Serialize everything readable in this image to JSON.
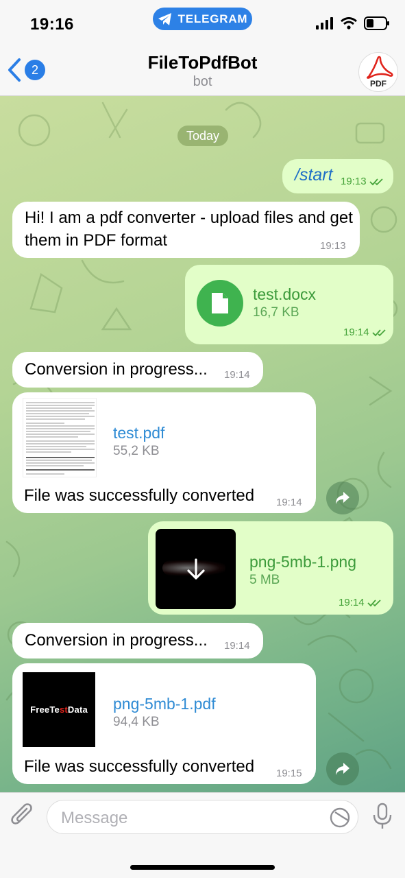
{
  "status": {
    "time": "19:16",
    "app_pill": "TELEGRAM"
  },
  "header": {
    "back_count": "2",
    "title": "FileToPdfBot",
    "subtitle": "bot",
    "avatar_label": "PDF"
  },
  "chat": {
    "date_label": "Today",
    "messages": [
      {
        "text": "/start",
        "time": "19:13"
      },
      {
        "text": "Hi! I am a pdf converter - upload files and get them in PDF format",
        "time": "19:13"
      },
      {
        "file_name": "test.docx",
        "file_size": "16,7 KB",
        "time": "19:14"
      },
      {
        "text": "Conversion in progress...",
        "time": "19:14"
      },
      {
        "file_name": "test.pdf",
        "file_size": "55,2 KB",
        "caption": "File was successfully converted",
        "time": "19:14"
      },
      {
        "file_name": "png-5mb-1.png",
        "file_size": "5 MB",
        "time": "19:14"
      },
      {
        "text": "Conversion in progress...",
        "time": "19:14"
      },
      {
        "file_name": "png-5mb-1.pdf",
        "file_size": "94,4 KB",
        "thumb_text": "FreeTestData",
        "caption": "File was successfully converted",
        "time": "19:15"
      }
    ]
  },
  "input": {
    "placeholder": "Message"
  },
  "colors": {
    "accent": "#2d81e6",
    "outgoing_bubble": "#e2fec8",
    "incoming_bubble": "#ffffff",
    "file_green": "#3fb34f"
  }
}
